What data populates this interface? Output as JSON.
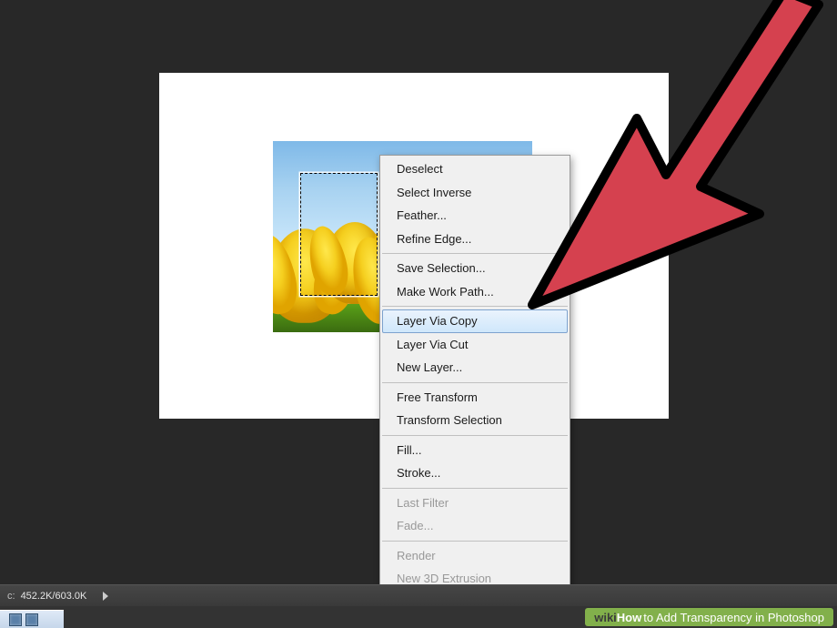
{
  "canvas": {
    "selection_label": "rectangular-selection"
  },
  "context_menu": {
    "groups": [
      [
        {
          "label": "Deselect",
          "name": "menu-deselect",
          "disabled": false
        },
        {
          "label": "Select Inverse",
          "name": "menu-select-inverse",
          "disabled": false
        },
        {
          "label": "Feather...",
          "name": "menu-feather",
          "disabled": false
        },
        {
          "label": "Refine Edge...",
          "name": "menu-refine-edge",
          "disabled": false
        }
      ],
      [
        {
          "label": "Save Selection...",
          "name": "menu-save-selection",
          "disabled": false
        },
        {
          "label": "Make Work Path...",
          "name": "menu-make-work-path",
          "disabled": false
        }
      ],
      [
        {
          "label": "Layer Via Copy",
          "name": "menu-layer-via-copy",
          "disabled": false,
          "highlighted": true
        },
        {
          "label": "Layer Via Cut",
          "name": "menu-layer-via-cut",
          "disabled": false
        },
        {
          "label": "New Layer...",
          "name": "menu-new-layer",
          "disabled": false
        }
      ],
      [
        {
          "label": "Free Transform",
          "name": "menu-free-transform",
          "disabled": false
        },
        {
          "label": "Transform Selection",
          "name": "menu-transform-selection",
          "disabled": false
        }
      ],
      [
        {
          "label": "Fill...",
          "name": "menu-fill",
          "disabled": false
        },
        {
          "label": "Stroke...",
          "name": "menu-stroke",
          "disabled": false
        }
      ],
      [
        {
          "label": "Last Filter",
          "name": "menu-last-filter",
          "disabled": true
        },
        {
          "label": "Fade...",
          "name": "menu-fade",
          "disabled": true
        }
      ],
      [
        {
          "label": "Render",
          "name": "menu-render",
          "disabled": true
        },
        {
          "label": "New 3D Extrusion",
          "name": "menu-new-3d-extrusion",
          "disabled": true
        }
      ]
    ]
  },
  "status": {
    "label_prefix": "c:",
    "doc_size": "452.2K/603.0K"
  },
  "watermark": {
    "brand_prefix": "wiki",
    "brand_suffix": "How",
    "tail": " to Add Transparency in Photoshop"
  },
  "arrow": {
    "fill": "#d5414f",
    "stroke": "#000000"
  }
}
